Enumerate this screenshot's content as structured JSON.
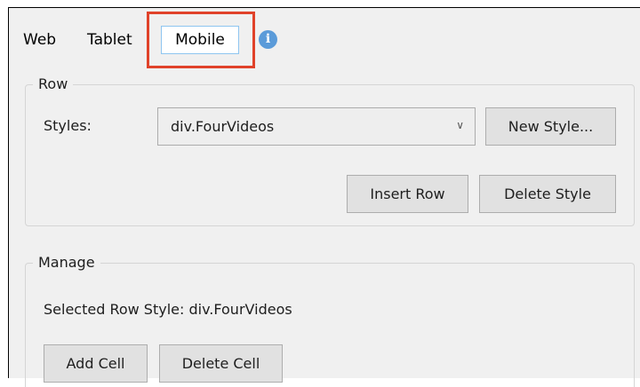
{
  "tabs": [
    {
      "label": "Web",
      "selected": false
    },
    {
      "label": "Tablet",
      "selected": false
    },
    {
      "label": "Mobile",
      "selected": true
    }
  ],
  "info_icon": {
    "glyph": "i",
    "icon": "info-icon",
    "color": "#5b9bd9"
  },
  "highlight_color": "#e0422a",
  "row_group": {
    "title": "Row",
    "styles_label": "Styles:",
    "styles_selected": "div.FourVideos",
    "new_style_button": "New Style...",
    "insert_row_button": "Insert Row",
    "delete_style_button": "Delete Style"
  },
  "manage_group": {
    "title": "Manage",
    "selected_row_style_text": "Selected Row Style: div.FourVideos",
    "add_cell_button": "Add Cell",
    "delete_cell_button": "Delete Cell"
  }
}
